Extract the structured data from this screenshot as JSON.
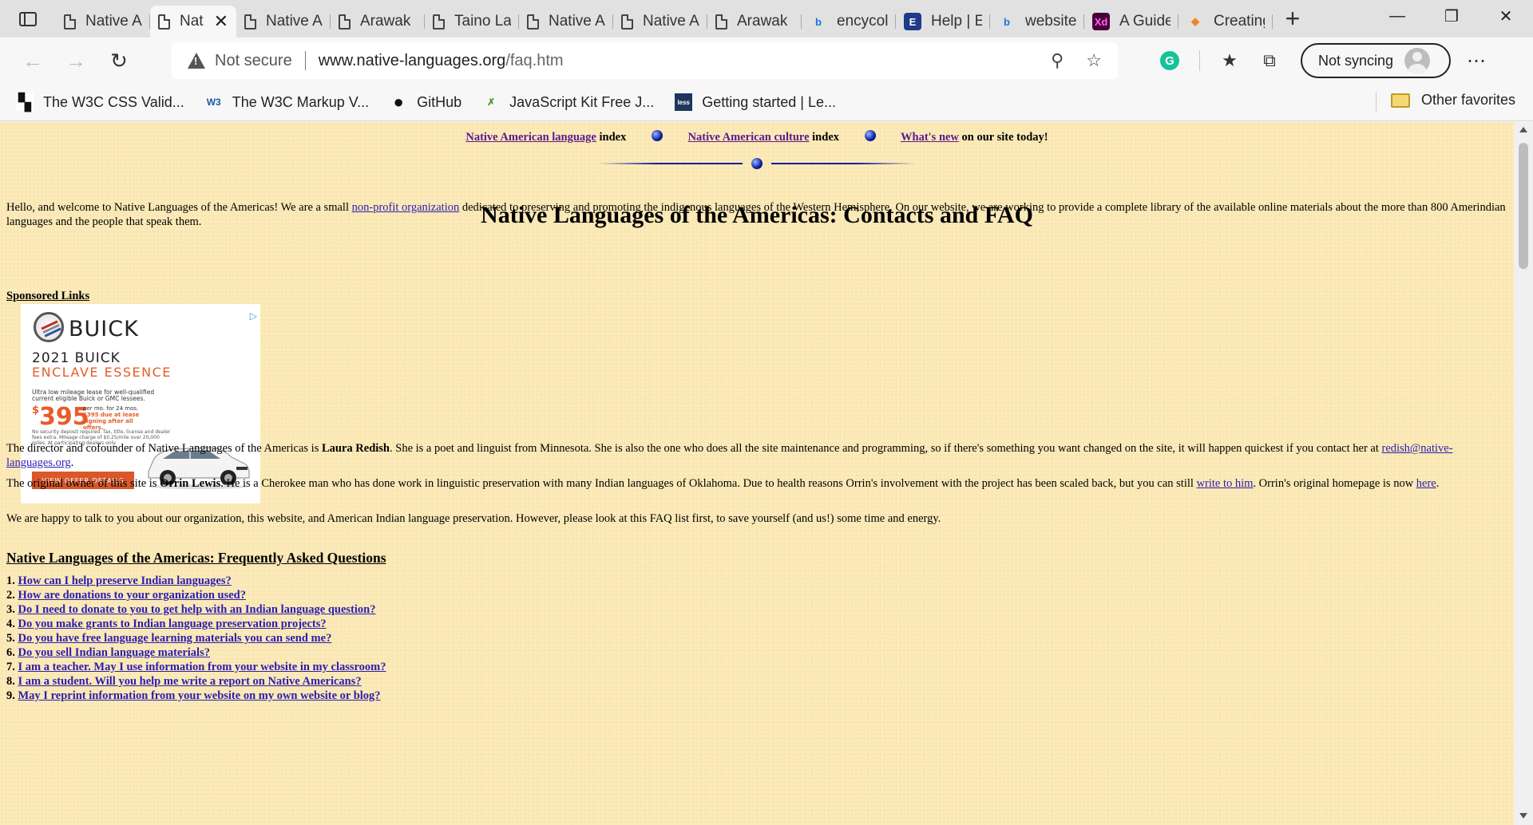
{
  "browser": {
    "tabs": [
      {
        "label": "Native A",
        "icon": "document-icon"
      },
      {
        "label": "Nat",
        "icon": "document-icon",
        "active": true
      },
      {
        "label": "Native A",
        "icon": "document-icon"
      },
      {
        "label": "Arawak",
        "icon": "document-icon"
      },
      {
        "label": "Taino La",
        "icon": "document-icon"
      },
      {
        "label": "Native A",
        "icon": "document-icon"
      },
      {
        "label": "Native A",
        "icon": "document-icon"
      },
      {
        "label": "Arawak",
        "icon": "document-icon"
      },
      {
        "label": "encycol",
        "icon": "bing-icon"
      },
      {
        "label": "Help | E",
        "icon": "e-icon"
      },
      {
        "label": "website",
        "icon": "bing-icon"
      },
      {
        "label": "A Guide",
        "icon": "xd-icon"
      },
      {
        "label": "Creating",
        "icon": "flame-icon"
      }
    ],
    "close_glyph": "✕",
    "new_tab_glyph": "+",
    "address": {
      "security_label": "Not secure",
      "host": "www.native-languages.org",
      "path": "/faq.htm"
    },
    "sync_label": "Not syncing",
    "bookmarks": [
      {
        "label": "The W3C CSS Valid...",
        "icon": "w3c-css-icon"
      },
      {
        "label": "The W3C Markup V...",
        "icon": "w3c-icon"
      },
      {
        "label": "GitHub",
        "icon": "github-icon"
      },
      {
        "label": "JavaScript Kit Free J...",
        "icon": "jskit-icon"
      },
      {
        "label": "Getting started | Le...",
        "icon": "less-icon"
      }
    ],
    "other_favorites": "Other favorites"
  },
  "page": {
    "nav": {
      "link1": "Native American language",
      "text1": " index",
      "link2": "Native American culture",
      "text2": " index",
      "link3": "What's new",
      "text3": " on our site today!"
    },
    "title": "Native Languages of the Americas: Contacts and FAQ",
    "intro": {
      "before": "Hello, and welcome to Native Languages of the Americas! We are a small ",
      "link": "non-profit organization",
      "after": " dedicated to preserving and promoting the indigenous languages of the Western Hemisphere. On our website, we are working to provide a complete library of the available online materials about the more than 800 Amerindian languages and the people that speak them."
    },
    "sponsored": "Sponsored Links",
    "ad": {
      "brand": "BUICK",
      "model_line1": "2021 BUICK",
      "model_line2": "ENCLAVE ESSENCE",
      "fine1": "Ultra low mileage lease for well-qualified current eligible Buick or GMC lessees.",
      "price": "395",
      "price_symbol": "$",
      "price_terms": "per mo. for 24 mos.",
      "price_due": "$395 due at lease signing after all offers.",
      "fine2": "No security deposit required. Tax, title, license and dealer fees extra. Mileage charge of $0.25/mile over 20,000 miles. At participating dealers only.",
      "cta": "VIEW OFFER DETAILS",
      "adchoices": "▷"
    },
    "director": {
      "before": "The director and cofounder of Native Languages of the Americas is ",
      "name": "Laura Redish",
      "after": ". She is a poet and linguist from Minnesota. She is also the one who does all the site maintenance and programming, so if there's something you want changed on the site, it will happen quickest if you contact her at ",
      "email": "redish@native-languages.org",
      "end": "."
    },
    "owner": {
      "before": "The original owner of this site is ",
      "name": "Orrin Lewis",
      "middle": ". He is a Cherokee man who has done work in linguistic preservation with many Indian languages of Oklahoma. Due to health reasons Orrin's involvement with the project has been scaled back, but you can still ",
      "link1": "write to him",
      "middle2": ". Orrin's original homepage is now ",
      "link2": "here",
      "end": "."
    },
    "happy": "We are happy to talk to you about our organization, this website, and American Indian language preservation. However, please look at this FAQ list first, to save yourself (and us!) some time and energy.",
    "faq_heading": "Native Languages of the Americas: Frequently Asked Questions",
    "faq": [
      {
        "num": "1.",
        "q": "How can I help preserve Indian languages?"
      },
      {
        "num": "2.",
        "q": "How are donations to your organization used?"
      },
      {
        "num": "3.",
        "q": "Do I need to donate to you to get help with an Indian language question?"
      },
      {
        "num": "4.",
        "q": "Do you make grants to Indian language preservation projects?"
      },
      {
        "num": "5.",
        "q": "Do you have free language learning materials you can send me?"
      },
      {
        "num": "6.",
        "q": "Do you sell Indian language materials?"
      },
      {
        "num": "7.",
        "q": "I am a teacher. May I use information from your website in my classroom?"
      },
      {
        "num": "8.",
        "q": "I am a student. Will you help me write a report on Native Americans?"
      },
      {
        "num": "9.",
        "q": "May I reprint information from your website on my own website or blog?"
      }
    ]
  },
  "colors": {
    "page_bg": "#fbe9b7",
    "link": "#2b1eb0",
    "visited_link": "#5b1a8a",
    "ad_accent": "#e65c2a"
  }
}
